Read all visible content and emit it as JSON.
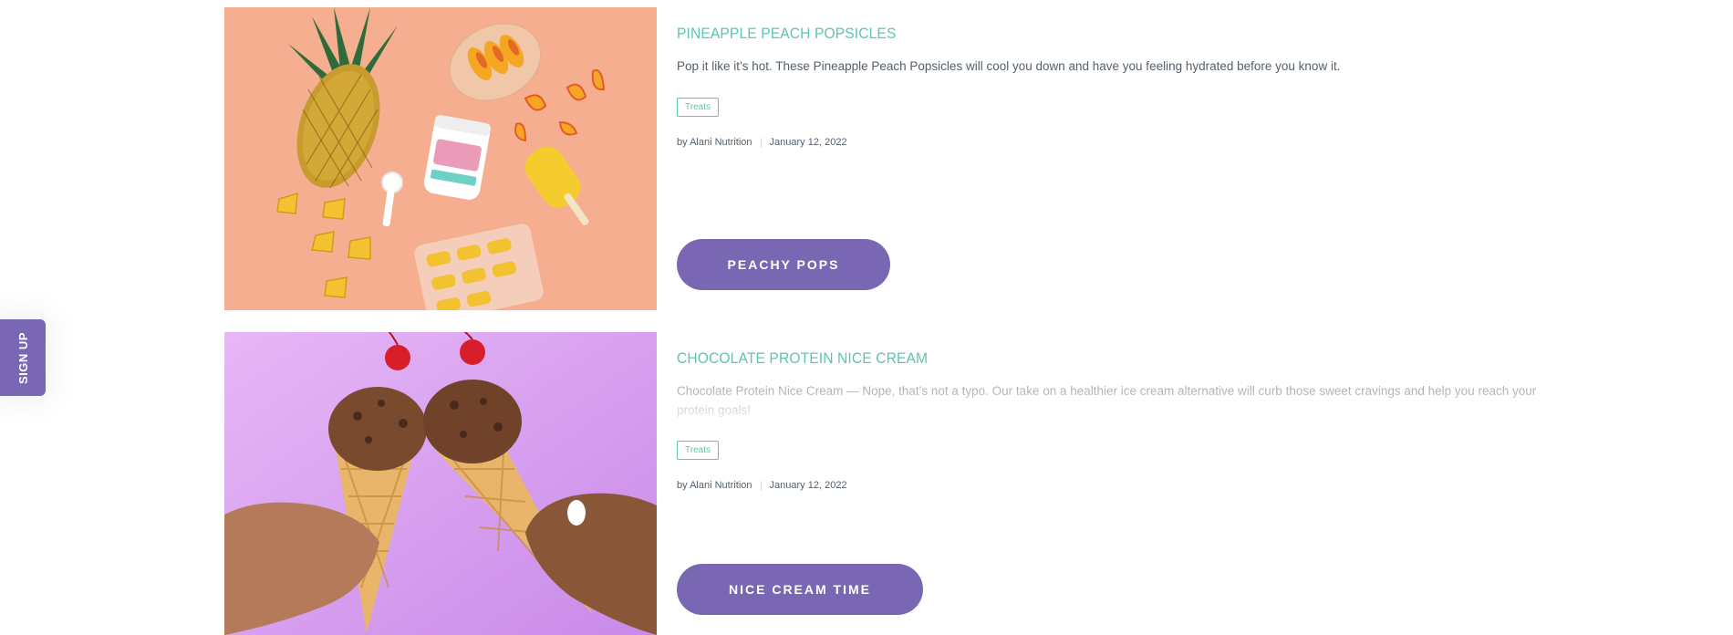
{
  "signup_tab": {
    "label": "SIGN UP"
  },
  "posts": [
    {
      "title": "PINEAPPLE PEACH POPSICLES",
      "excerpt": "Pop it like it’s hot. These Pineapple Peach Popsicles will cool you down and have you feeling hydrated before you know it.",
      "tag": "Treats",
      "author": "by Alani Nutrition",
      "date": "January 12, 2022",
      "button": "PEACHY POPS"
    },
    {
      "title": "CHOCOLATE PROTEIN NICE CREAM",
      "excerpt": "Chocolate Protein Nice Cream — Nope, that’s not a typo. Our take on a healthier ice cream alternative will curb those sweet cravings and help you reach your protein goals!",
      "tag": "Treats",
      "author": "by Alani Nutrition",
      "date": "January 12, 2022",
      "button": "NICE CREAM TIME"
    }
  ],
  "colors": {
    "accent_teal": "#5fc4b0",
    "button_purple": "#7a67b3",
    "text": "#55606b",
    "peach_background": "#f6ae91",
    "lavender_background": "#d79af0"
  }
}
